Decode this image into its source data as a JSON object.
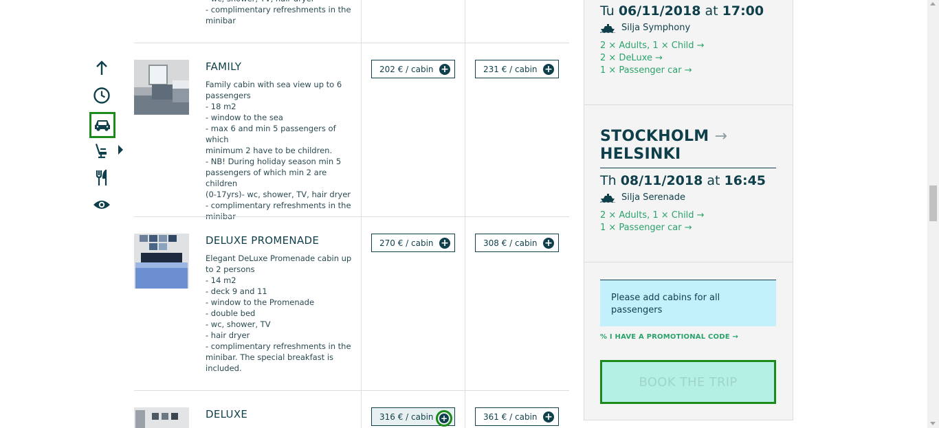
{
  "cabins": {
    "top_desc_fragment": "- wc, shower, TV, hair dryer\n- complimentary refreshments in the\nminibar",
    "rows": [
      {
        "title": "FAMILY",
        "description": "Family cabin with sea view up to 6\npassengers\n- 18 m2\n- window to the sea\n- max 6 and min 5 passengers of which\nminimum 2 have to be children.\n- NB! During holiday season min 5\npassengers of which min 2 are children\n(0-17yrs)- wc,  shower, TV, hair dryer\n- complimentary refreshments in the\nminibar",
        "price1": "202 € / cabin",
        "price2": "231 € / cabin"
      },
      {
        "title": "DELUXE PROMENADE",
        "description": "Elegant DeLuxe Promenade cabin up\nto 2 persons\n- 14 m2\n- deck 9 and 11\n- window to the Promenade\n- double bed\n- wc, shower, TV\n- hair dryer\n- complimentary refreshments in the\nminibar. The special breakfast is\nincluded.",
        "price1": "270 € / cabin",
        "price2": "308 € / cabin"
      },
      {
        "title": "DELUXE",
        "description": "",
        "price1": "316 € / cabin",
        "price2": "361 € / cabin"
      }
    ]
  },
  "summary": {
    "outbound": {
      "day": "Tu",
      "date": "06/11/2018",
      "at": "at",
      "time": "17:00",
      "ship": "Silja Symphony",
      "links": [
        "2 × Adults, 1 × Child →",
        "2 × DeLuxe →",
        "1 × Passenger car  →"
      ]
    },
    "return": {
      "route_from": "STOCKHOLM",
      "route_arrow": "→",
      "route_to": "HELSINKI",
      "day": "Th",
      "date": "08/11/2018",
      "at": "at",
      "time": "16:45",
      "ship": "Silja Serenade",
      "links": [
        "2 × Adults, 1 × Child →",
        "1 × Passenger car  →"
      ]
    },
    "notice": "Please add cabins for all passengers",
    "promo": "% I HAVE A PROMOTIONAL CODE →",
    "book": "BOOK THE TRIP"
  },
  "colors": {
    "brand_dark": "#0e3f4a",
    "link_green": "#2aa36b",
    "notice_bg": "#c2f0fb",
    "book_bg": "#b4f0e3",
    "highlight": "#1b8a1b"
  },
  "icons": {
    "nav": [
      "arrow-up-icon",
      "clock-icon",
      "car-icon",
      "seat-icon",
      "fork-knife-icon",
      "eye-icon"
    ]
  }
}
